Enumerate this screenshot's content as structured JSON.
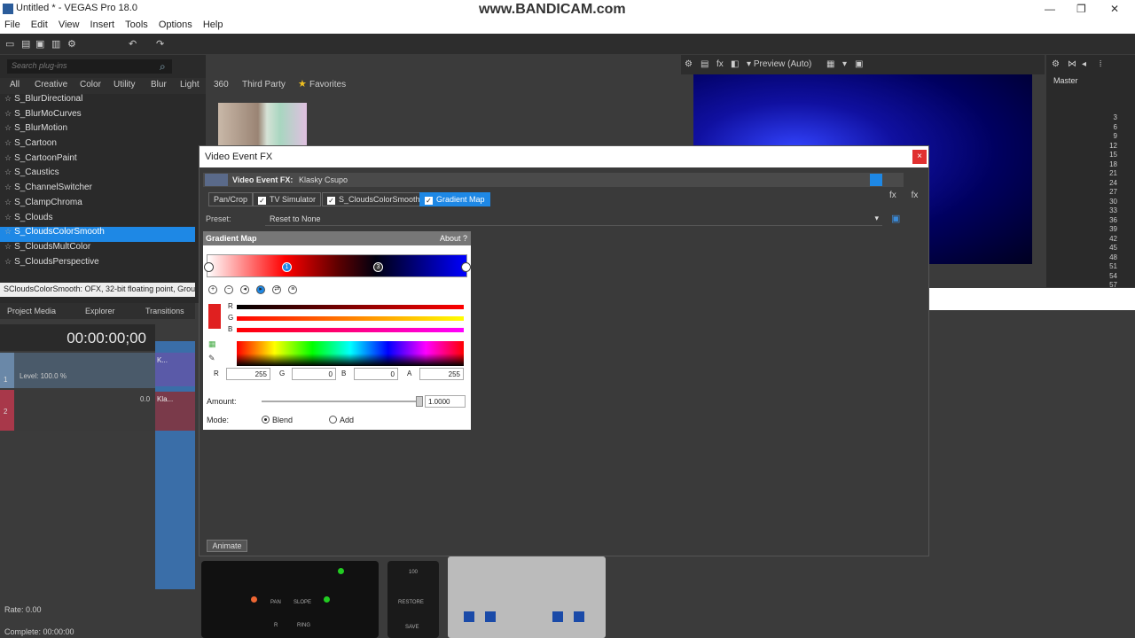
{
  "window": {
    "title": "Untitled * - VEGAS Pro 18.0",
    "watermark": "www.BANDICAM.com",
    "minimize": "—",
    "maximize": "❐",
    "close": "✕"
  },
  "menu": [
    "File",
    "Edit",
    "View",
    "Insert",
    "Tools",
    "Options",
    "Help"
  ],
  "plugins": {
    "search_placeholder": "Search plug-ins",
    "categories": [
      "All",
      "Creative",
      "Color",
      "Utility",
      "Blur",
      "Light",
      "360",
      "Third Party",
      "Favorites"
    ],
    "items": [
      "S_BlurDirectional",
      "S_BlurMoCurves",
      "S_BlurMotion",
      "S_Cartoon",
      "S_CartoonPaint",
      "S_Caustics",
      "S_ChannelSwitcher",
      "S_ClampChroma",
      "S_Clouds",
      "S_CloudsColorSmooth",
      "S_CloudsMultColor",
      "S_CloudsPerspective"
    ],
    "selected": "S_CloudsColorSmooth",
    "description": "SCloudsColorSmooth: OFX, 32-bit floating point, Group"
  },
  "panes": {
    "tabs": [
      "Project Media",
      "Explorer",
      "Transitions"
    ]
  },
  "timeline": {
    "timecode": "00:00:00;00",
    "track1": {
      "num": "1",
      "level": "Level: 100.0 %"
    },
    "track2": {
      "num": "2",
      "vol": "0.0"
    },
    "clip1": "K...",
    "clip2": "Kla...",
    "rate": "Rate: 0.00",
    "complete": "Complete: 00:00:00"
  },
  "preview": {
    "label": "Preview (Auto)"
  },
  "mixer": {
    "label": "Master",
    "scale": [
      "3",
      "6",
      "9",
      "12",
      "15",
      "18",
      "21",
      "24",
      "27",
      "30",
      "33",
      "36",
      "39",
      "42",
      "45",
      "48",
      "51",
      "54",
      "57"
    ]
  },
  "dialog": {
    "title": "Video Event FX",
    "close": "×",
    "header_label": "Video Event FX:",
    "header_value": "Klasky Csupo",
    "chain": [
      "Pan/Crop",
      "TV Simulator",
      "S_CloudsColorSmooth",
      "Gradient Map"
    ],
    "preset_label": "Preset:",
    "preset_value": "Reset to None",
    "gm_title": "Gradient Map",
    "gm_about": "About  ?",
    "stops": [
      "1",
      "3"
    ],
    "channels": [
      "R",
      "G",
      "B"
    ],
    "rgba": {
      "R": "255",
      "G": "0",
      "B": "0",
      "A": "255"
    },
    "amount_label": "Amount:",
    "amount": "1.0000",
    "amount_level": 1.0,
    "mode_label": "Mode:",
    "modes": [
      "Blend",
      "Add"
    ],
    "mode_selected": "Blend",
    "animate": "Animate"
  },
  "plugin_hw": {
    "eq_labels": [
      "PAN",
      "SLOPE",
      "R",
      "RING"
    ],
    "restore": "RESTORE",
    "save": "SAVE",
    "val100": "100"
  }
}
